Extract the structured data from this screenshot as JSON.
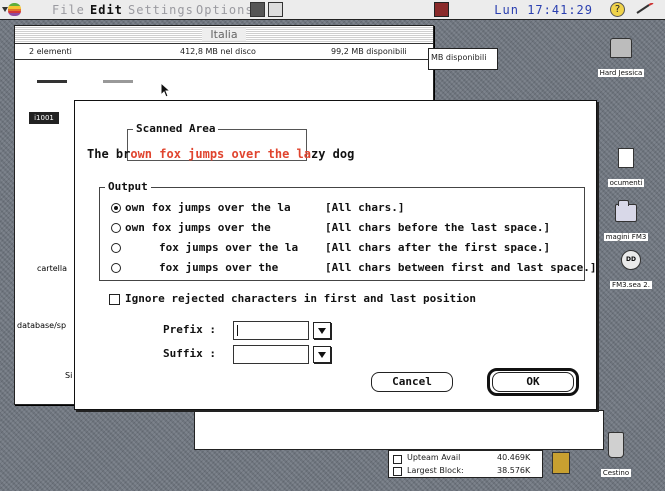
{
  "menubar": {
    "items": [
      "File",
      "Edit",
      "Settings",
      "Options"
    ],
    "clock": "Lun 17:41:29"
  },
  "finder": {
    "title": "Italia",
    "items_count": "2 elementi",
    "disk_used": "412,8 MB nel disco",
    "available": "99,2 MB disponibili",
    "available_2": "MB disponibili",
    "tile_label": "i1001",
    "side_labels": [
      "cartella",
      "database/sp",
      "Si"
    ]
  },
  "memory": {
    "upper_label": "Upteam Avail",
    "upper_value": "40.469K",
    "largest_label": "Largest Block:",
    "largest_value": "38.576K"
  },
  "dialog": {
    "scanned_area_label": "Scanned Area",
    "sample_prefix": "The br",
    "sample_highlight": "own fox jumps over the la",
    "sample_suffix": "zy dog",
    "output_label": "Output",
    "options": [
      {
        "text": "own fox jumps over the la",
        "desc": "[All chars.]",
        "selected": true
      },
      {
        "text": "own fox jumps over the",
        "desc": "[All chars before the last space.]",
        "selected": false
      },
      {
        "text": "fox jumps over the la",
        "desc": "[All chars after the first space.]",
        "selected": false
      },
      {
        "text": "fox jumps over the",
        "desc": "[All chars between first and last space.]",
        "selected": false
      }
    ],
    "ignore_label": "Ignore rejected characters in first and last position",
    "prefix_label": "Prefix :",
    "suffix_label": "Suffix :",
    "prefix_value": "",
    "suffix_value": "",
    "cancel_label": "Cancel",
    "ok_label": "OK",
    "highlight_color": "#e0442e"
  },
  "desktop_icons": [
    {
      "name": "Hard Jessica"
    },
    {
      "name": "ocumenti"
    },
    {
      "name": "magini FM3"
    },
    {
      "name": "FM3.sea 2."
    },
    {
      "name": "Cestino"
    }
  ]
}
